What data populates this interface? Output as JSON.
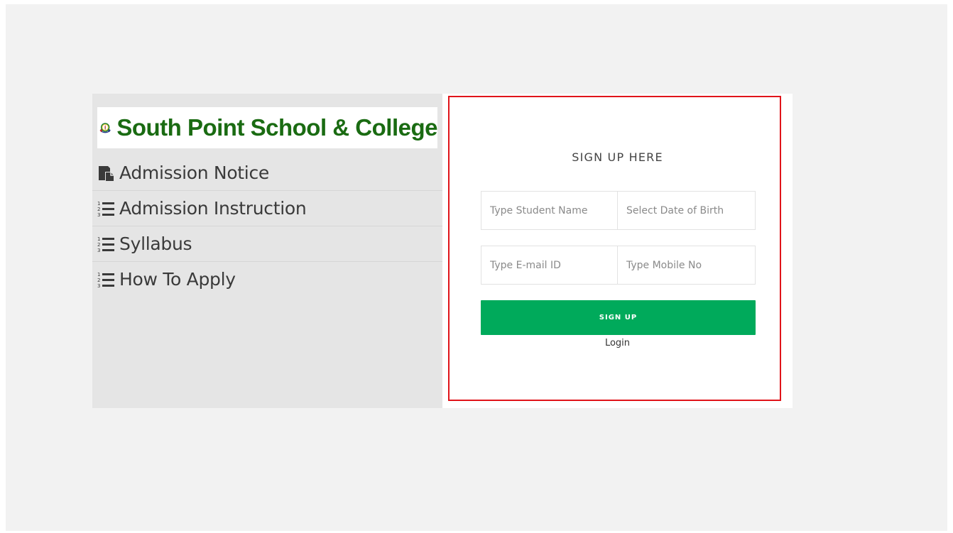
{
  "brand": {
    "school_name": "South Point School & College",
    "name_color": "#1a6b12"
  },
  "menu": {
    "items": [
      {
        "label": "Admission Notice",
        "icon": "clipboard-icon"
      },
      {
        "label": "Admission Instruction",
        "icon": "ordered-list-icon"
      },
      {
        "label": "Syllabus",
        "icon": "ordered-list-icon"
      },
      {
        "label": "How To Apply",
        "icon": "ordered-list-icon"
      }
    ]
  },
  "form": {
    "title": "SIGN UP HERE",
    "student_name_placeholder": "Type Student Name",
    "dob_placeholder": "Select Date of Birth",
    "email_placeholder": "Type E-mail ID",
    "mobile_placeholder": "Type Mobile No",
    "signup_label": "SIGN UP",
    "login_label": "Login",
    "button_color": "#00aa5b",
    "highlight_color": "#e0141a"
  }
}
